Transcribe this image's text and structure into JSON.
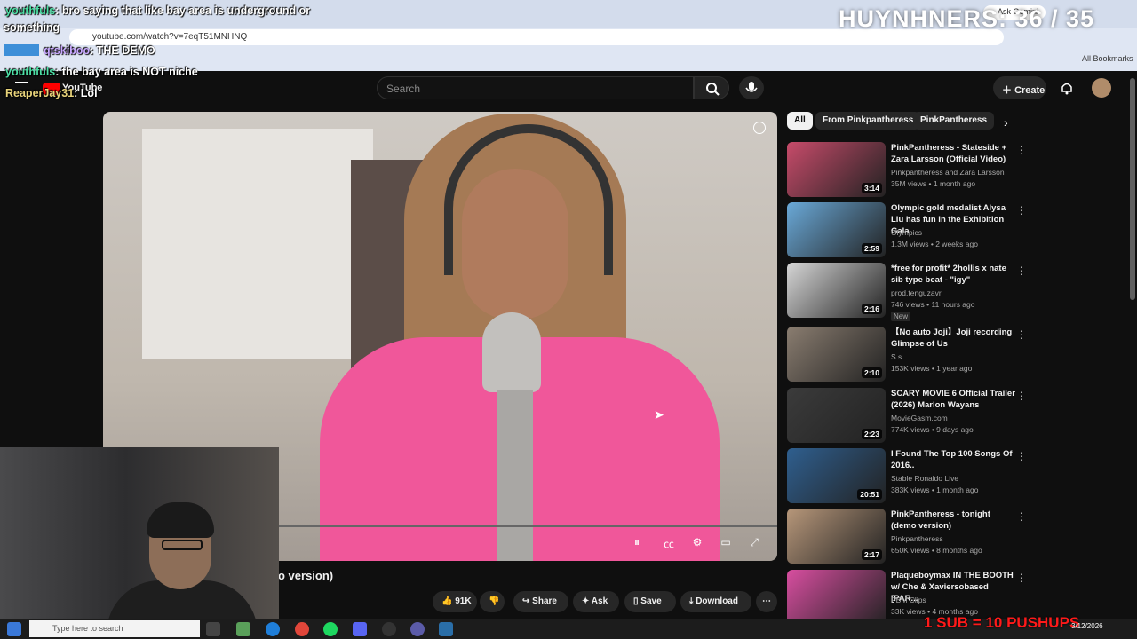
{
  "browser": {
    "url": "youtube.com/watch?v=7eqT51MNHNQ",
    "bookmarks_label": "All Bookmarks",
    "ask_label": "Ask Gemini"
  },
  "overlay": {
    "counter": "HUYNHNERS: 36 / 35",
    "pushups": "1 SUB = 10 PUSHUPS",
    "chat": [
      {
        "user": "youthfuls",
        "message": ": bro saying that like bay area is underground or"
      },
      {
        "user": "",
        "message": "something"
      },
      {
        "user": "qtskiboo",
        "message": ":  THE DEMO"
      },
      {
        "user": "youthfuls",
        "message": ": the bay area is NOT niche"
      },
      {
        "user": "ReaperJay31",
        "message": ": Lol"
      }
    ]
  },
  "youtube": {
    "logo_label": "YouTube",
    "search_placeholder": "Search",
    "create_label": "Create",
    "video_title_partial": "o version)",
    "actions": {
      "likes": "91K",
      "share": "Share",
      "ask": "Ask",
      "save": "Save",
      "download": "Download"
    },
    "chips": [
      "All",
      "From Pinkpantheress",
      "PinkPantheress"
    ],
    "recommendations": [
      {
        "title": "PinkPantheress - Stateside + Zara Larsson (Official Video)",
        "channel": "Pinkpantheress  and Zara Larsson",
        "meta": "35M views • 1 month ago",
        "duration": "3:14",
        "thumb_color": "#c74b6a"
      },
      {
        "title": "Olympic gold medalist Alysa Liu has fun in the Exhibition Gala",
        "channel": "Olympics",
        "meta": "1.3M views • 2 weeks ago",
        "duration": "2:59",
        "thumb_color": "#6aa9d8"
      },
      {
        "title": "*free for profit* 2hollis x nate sib type beat - \"igy\"",
        "channel": "prod.tenguzavr",
        "meta": "746 views • 11 hours ago",
        "duration": "2:16",
        "badge": "New",
        "thumb_color": "#d6d6d6"
      },
      {
        "title": "【No auto Joji】Joji recording Glimpse of Us",
        "channel": "S s",
        "meta": "153K views • 1 year ago",
        "duration": "2:10",
        "thumb_color": "#8a7d70"
      },
      {
        "title": "SCARY MOVIE 6 Official Trailer (2026) Marlon Wayans",
        "channel": "MovieGasm.com",
        "meta": "774K views • 9 days ago",
        "duration": "2:23",
        "thumb_color": "#3b3b3b"
      },
      {
        "title": "I Found The Top 100 Songs Of 2016..",
        "channel": "Stable Ronaldo Live",
        "meta": "383K views • 1 month ago",
        "duration": "20:51",
        "thumb_color": "#2f5f8f"
      },
      {
        "title": "PinkPantheress - tonight (demo version)",
        "channel": "Pinkpantheress",
        "meta": "650K views • 8 months ago",
        "duration": "2:17",
        "thumb_color": "#b7977a"
      },
      {
        "title": "Plaqueboymax IN THE BOOTH w/ Che & Xaviersobased [PAR...",
        "channel": "PBM Clips",
        "meta": "33K views • 4 months ago",
        "duration": "",
        "thumb_color": "#d84ea0"
      }
    ]
  },
  "taskbar": {
    "search_placeholder": "Type here to search",
    "date": "3/12/2026"
  }
}
